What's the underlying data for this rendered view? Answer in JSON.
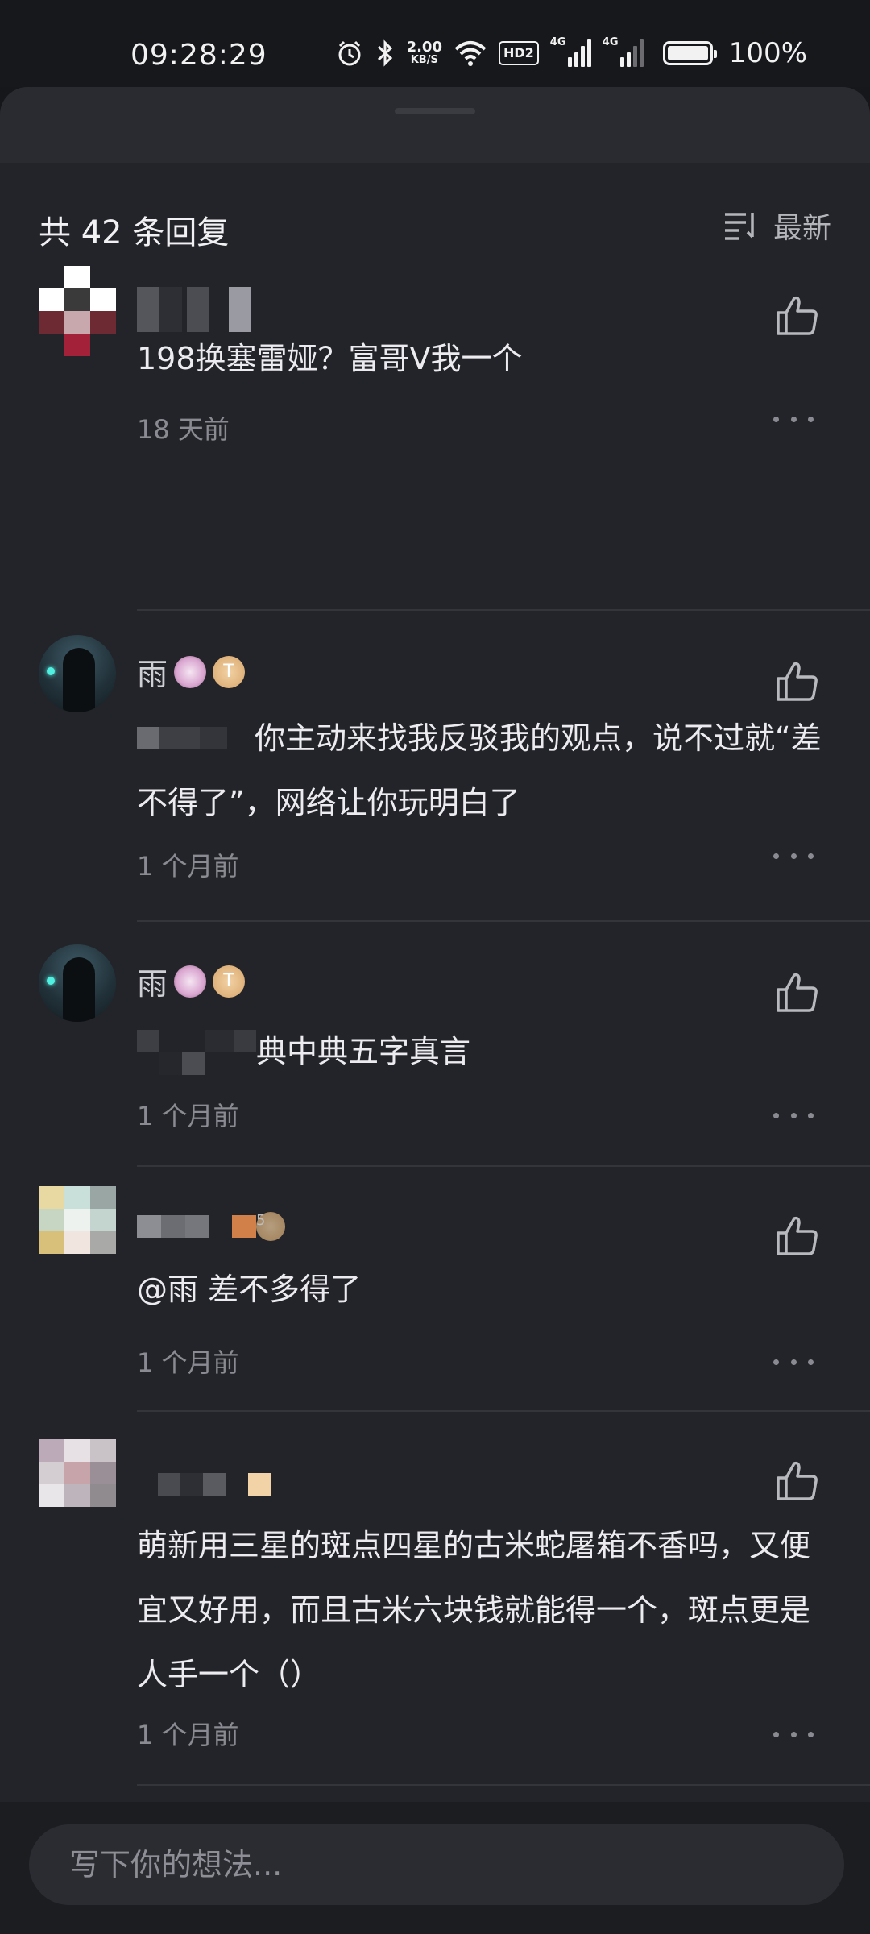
{
  "status_bar": {
    "time": "09:28:29",
    "net_speed_value": "2.00",
    "net_speed_unit": "KB/S",
    "hd_label": "HD2",
    "signal1_label": "4G",
    "signal2_label": "4G",
    "battery_percent": "100%",
    "icons": [
      "alarm-icon",
      "bluetooth-icon",
      "wifi-icon",
      "hd-icon",
      "signal-icon",
      "signal-icon",
      "battery-icon"
    ]
  },
  "header": {
    "reply_count": "共 42 条回复",
    "sort_label": "最新"
  },
  "comments": [
    {
      "username": "",
      "text": "198换塞雷娅？富哥V我一个",
      "time": "18 天前"
    },
    {
      "username": "雨",
      "badge_text": "T",
      "text": "你主动来找我反驳我的观点，说不过就“差不得了”，网络让你玩明白了",
      "time": "1 个月前"
    },
    {
      "username": "雨",
      "badge_text": "T",
      "text": "典中典五字真言",
      "time": "1 个月前"
    },
    {
      "username": "",
      "badge_text": "5",
      "text": "@雨  差不多得了",
      "time": "1 个月前"
    },
    {
      "username": "",
      "text": "萌新用三星的斑点四星的古米蛇屠箱不香吗，又便宜又好用，而且古米六块钱就能得一个，斑点更是人手一个（）",
      "time": "1 个月前"
    },
    {
      "username": "",
      "text": "",
      "time": ""
    }
  ],
  "input": {
    "placeholder": "写下你的想法..."
  },
  "colors": {
    "background": "#16171b",
    "sheet": "#232429",
    "text_primary": "#ececf0",
    "text_secondary": "#8a8b92",
    "badge_gold": "#d7a46a"
  }
}
